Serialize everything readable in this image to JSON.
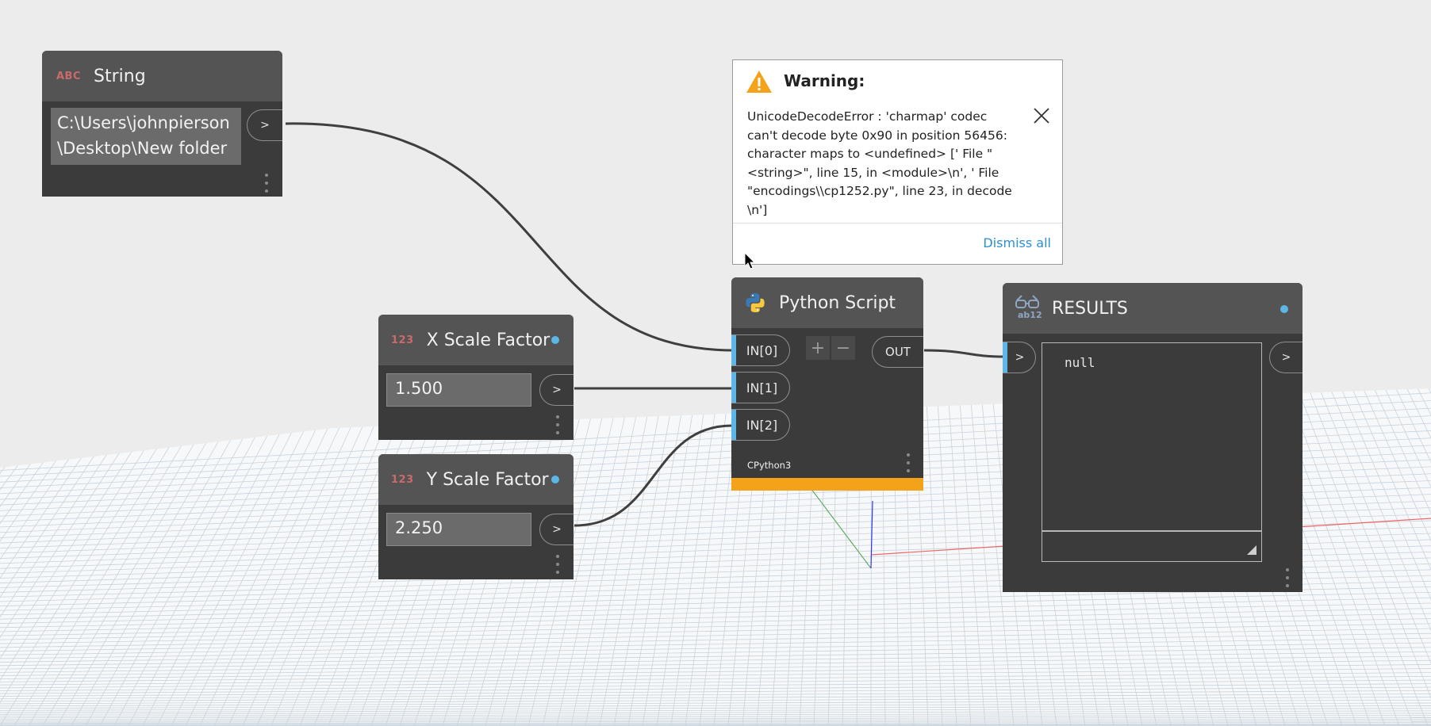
{
  "nodes": {
    "string": {
      "type_badge": "ABC",
      "title": "String",
      "value_line1": "C:\\Users\\johnpierson",
      "value_line2": "\\Desktop\\New folder",
      "output_label": ">"
    },
    "x_scale": {
      "type_badge": "123",
      "title": "X Scale Factor",
      "value": "1.500",
      "output_label": ">"
    },
    "y_scale": {
      "type_badge": "123",
      "title": "Y Scale Factor",
      "value": "2.250",
      "output_label": ">"
    },
    "python": {
      "title": "Python Script",
      "inputs": [
        "IN[0]",
        "IN[1]",
        "IN[2]"
      ],
      "output_label": "OUT",
      "add_label": "+",
      "remove_label": "−",
      "engine": "CPython3",
      "status_color": "#f5a21b"
    },
    "results": {
      "badge": "ab12",
      "title": "RESULTS",
      "input_label": ">",
      "output_label": ">",
      "value": "null"
    }
  },
  "warning": {
    "title": "Warning:",
    "message": "UnicodeDecodeError : 'charmap' codec can't decode byte 0x90 in position 56456: character maps to <undefined> ['  File \"<string>\", line 15, in <module>\\n', '  File \"encodings\\\\cp1252.py\", line 23, in decode \\n']",
    "dismiss_label": "Dismiss all"
  },
  "colors": {
    "background": "#ececec",
    "node_body": "#3b3b3b",
    "node_header": "#545454",
    "port_accent": "#5db7e6",
    "warning_orange": "#f5a21b",
    "link_blue": "#2c8fd6"
  }
}
